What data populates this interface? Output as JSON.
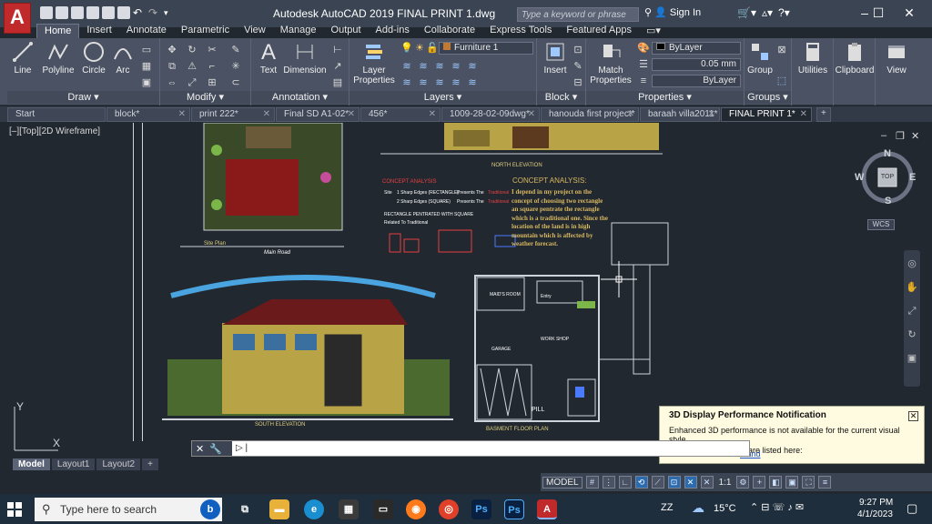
{
  "app": {
    "title": "Autodesk AutoCAD 2019    FINAL PRINT 1.dwg",
    "logo_letter": "A",
    "search_placeholder": "Type a keyword or phrase",
    "sign_in": "Sign In"
  },
  "window_controls": {
    "minimize": "–",
    "maximize": "☐",
    "close": "✕"
  },
  "ribbon_tabs": [
    "Home",
    "Insert",
    "Annotate",
    "Parametric",
    "View",
    "Manage",
    "Output",
    "Add-ins",
    "Collaborate",
    "Express Tools",
    "Featured Apps"
  ],
  "ribbon": {
    "draw": {
      "title": "Draw ▾",
      "line": "Line",
      "polyline": "Polyline",
      "circle": "Circle",
      "arc": "Arc"
    },
    "modify": {
      "title": "Modify ▾"
    },
    "annotation": {
      "title": "Annotation ▾",
      "text": "Text",
      "dimension": "Dimension"
    },
    "layers": {
      "title": "Layers ▾",
      "layer_properties": "Layer Properties",
      "current_layer": "Furniture 1"
    },
    "block": {
      "title": "Block ▾",
      "insert": "Insert"
    },
    "properties": {
      "title": "Properties ▾",
      "match": "Match Properties",
      "color": "ByLayer",
      "lineweight": "0.05 mm",
      "linetype": "ByLayer"
    },
    "groups": {
      "title": "Groups ▾",
      "group": "Group"
    },
    "utilities": "Utilities",
    "clipboard": "Clipboard",
    "view": "View"
  },
  "file_tabs": [
    "Start",
    "block*",
    "print 222*",
    "Final SD A1-02*",
    "456*",
    "1009-28-02-09dwg*",
    "hanouda first project*",
    "baraah villa2011*",
    "FINAL PRINT 1*"
  ],
  "viewport": {
    "label": "[–][Top][2D Wireframe]",
    "viewcube": {
      "n": "N",
      "s": "S",
      "e": "E",
      "w": "W",
      "top": "TOP",
      "wcs": "WCS"
    }
  },
  "drawing": {
    "site_plan_label": "Site Plan",
    "main_road": "Main Road",
    "north_elevation": "NORTH ELEVATION",
    "concept_heading": "CONCEPT ANALYSIS",
    "concept_text": "CONCEPT ANALYSIS:",
    "concept_body": "I depend in my project on the concept of choosing two rectangle an square pentrate the rectangle which is a traditional one. Since the location of the land is in high mountain which is affected by weather forecast.",
    "south_elevation": "SOUTH ELEVATION",
    "basement_plan": "BASMENT FLOOR PLAN",
    "scale": "Sc. 1/100",
    "rect_note": "1 Sharp Edges (RECTANGLE)",
    "square_note": "2 Sharp Edges (SQUARE)",
    "presents": "Presents The",
    "traditional": "Traditional",
    "site": "Site",
    "related": "RECTANGLE PENTRATED WITH SQUARE",
    "related2": "Related To Traditional",
    "room_labels": [
      "MAID'S ROOM",
      "Entry",
      "WORK SHOP",
      "GARAGE",
      "PILL",
      "STORE"
    ]
  },
  "notification": {
    "title": "3D Display Performance Notification",
    "body": "Enhanced 3D performance is not available for the current visual style.",
    "body2": "The required settings are listed here:",
    "link": "mand"
  },
  "command_line": {
    "prompt": "▷",
    "text": ""
  },
  "layout_tabs": [
    "Model",
    "Layout1",
    "Layout2",
    "+"
  ],
  "statusbar": {
    "model": "MODEL",
    "scale": "1:1"
  },
  "taskbar": {
    "search": "Type here to search",
    "weather": "15°C",
    "time": "9:27 PM",
    "date": "4/1/2023",
    "zz": "ZZ"
  },
  "colors": {
    "accent": "#c12a2a",
    "ribbon": "#4a5263",
    "canvas": "#212830",
    "titlebar": "#3b4453"
  }
}
